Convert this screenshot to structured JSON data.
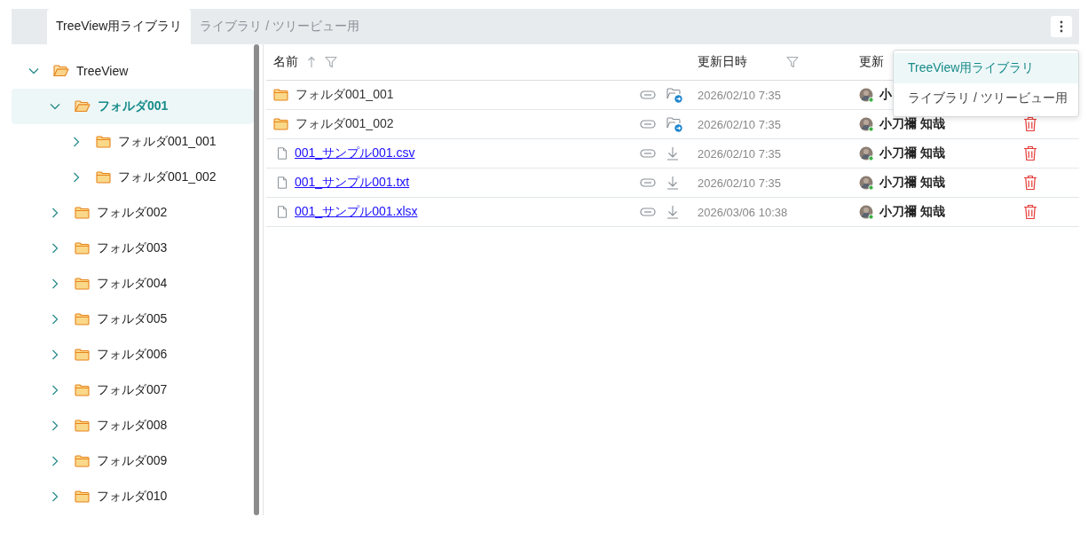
{
  "tabs": [
    {
      "label": "TreeView用ライブラリ",
      "selected": true
    },
    {
      "label": "ライブラリ / ツリービュー用",
      "selected": false
    }
  ],
  "tree": [
    {
      "label": "TreeView",
      "expanded": true,
      "selected": false,
      "children": [
        {
          "label": "フォルダ001",
          "expanded": true,
          "selected": true,
          "children": [
            {
              "label": "フォルダ001_001",
              "expanded": false,
              "selected": false
            },
            {
              "label": "フォルダ001_002",
              "expanded": false,
              "selected": false
            }
          ]
        },
        {
          "label": "フォルダ002",
          "expanded": false,
          "selected": false
        },
        {
          "label": "フォルダ003",
          "expanded": false,
          "selected": false
        },
        {
          "label": "フォルダ004",
          "expanded": false,
          "selected": false
        },
        {
          "label": "フォルダ005",
          "expanded": false,
          "selected": false
        },
        {
          "label": "フォルダ006",
          "expanded": false,
          "selected": false
        },
        {
          "label": "フォルダ007",
          "expanded": false,
          "selected": false
        },
        {
          "label": "フォルダ008",
          "expanded": false,
          "selected": false
        },
        {
          "label": "フォルダ009",
          "expanded": false,
          "selected": false
        },
        {
          "label": "フォルダ010",
          "expanded": false,
          "selected": false
        }
      ]
    }
  ],
  "table": {
    "columns": [
      {
        "label": "名前",
        "sorted_ascending": true,
        "filter": true
      },
      {
        "label": "更新日時",
        "filter": true
      },
      {
        "label": "更新"
      }
    ],
    "rows": [
      {
        "kind": "folder",
        "name": "フォルダ001_001",
        "modified": "2026/02/10 7:35",
        "author": "小",
        "delete_button": false
      },
      {
        "kind": "folder",
        "name": "フォルダ001_002",
        "modified": "2026/02/10 7:35",
        "author": "小刀禰 知哉",
        "delete_button": true
      },
      {
        "kind": "file",
        "name": "001_サンプル001.csv",
        "modified": "2026/02/10 7:35",
        "author": "小刀禰 知哉",
        "delete_button": true
      },
      {
        "kind": "file",
        "name": "001_サンプル001.txt",
        "modified": "2026/02/10 7:35",
        "author": "小刀禰 知哉",
        "delete_button": true
      },
      {
        "kind": "file",
        "name": "001_サンプル001.xlsx",
        "modified": "2026/03/06 10:38",
        "author": "小刀禰 知哉",
        "delete_button": true
      }
    ]
  },
  "menu": {
    "items": [
      {
        "label": "TreeView用ライブラリ",
        "selected": true
      },
      {
        "label": "ライブラリ / ツリービュー用",
        "selected": false
      }
    ]
  }
}
